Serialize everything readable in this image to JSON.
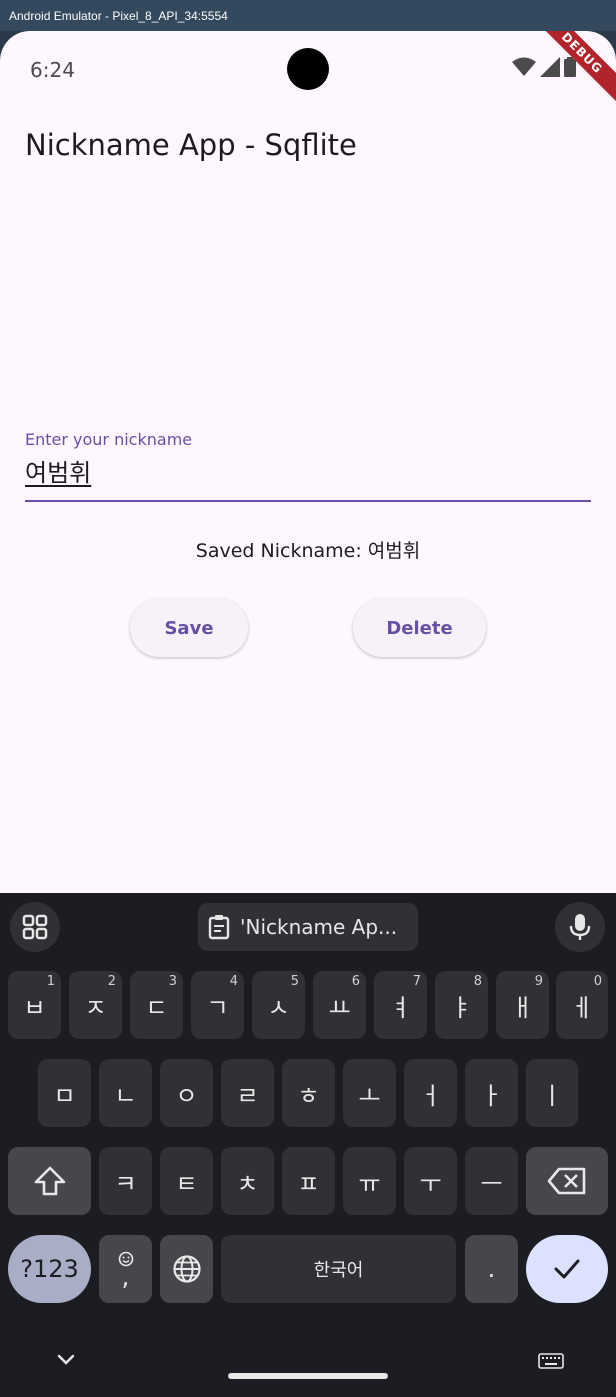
{
  "window": {
    "title": "Android Emulator - Pixel_8_API_34:5554"
  },
  "status_bar": {
    "time": "6:24",
    "debug_label": "DEBUG"
  },
  "app": {
    "title": "Nickname App - Sqflite",
    "input": {
      "label": "Enter your nickname",
      "value": "여범휘"
    },
    "saved_text": "Saved Nickname: 여범휘",
    "save_label": "Save",
    "delete_label": "Delete"
  },
  "keyboard": {
    "suggestion": "'Nickname Ap...",
    "row1": [
      {
        "label": "ㅂ",
        "hint": "1"
      },
      {
        "label": "ㅈ",
        "hint": "2"
      },
      {
        "label": "ㄷ",
        "hint": "3"
      },
      {
        "label": "ㄱ",
        "hint": "4"
      },
      {
        "label": "ㅅ",
        "hint": "5"
      },
      {
        "label": "ㅛ",
        "hint": "6"
      },
      {
        "label": "ㅕ",
        "hint": "7"
      },
      {
        "label": "ㅑ",
        "hint": "8"
      },
      {
        "label": "ㅐ",
        "hint": "9"
      },
      {
        "label": "ㅔ",
        "hint": "0"
      }
    ],
    "row2": [
      "ㅁ",
      "ㄴ",
      "ㅇ",
      "ㄹ",
      "ㅎ",
      "ㅗ",
      "ㅓ",
      "ㅏ",
      "ㅣ"
    ],
    "row3": [
      "ㅋ",
      "ㅌ",
      "ㅊ",
      "ㅍ",
      "ㅠ",
      "ㅜ",
      "ㅡ"
    ],
    "symbols_label": "?123",
    "emoji_comma_label": ",",
    "space_label": "한국어",
    "period_label": "."
  },
  "colors": {
    "accent": "#6750a4",
    "app_background": "#fef7ff",
    "keyboard_background": "#1c1d22",
    "debug_ribbon": "#b3232b"
  }
}
